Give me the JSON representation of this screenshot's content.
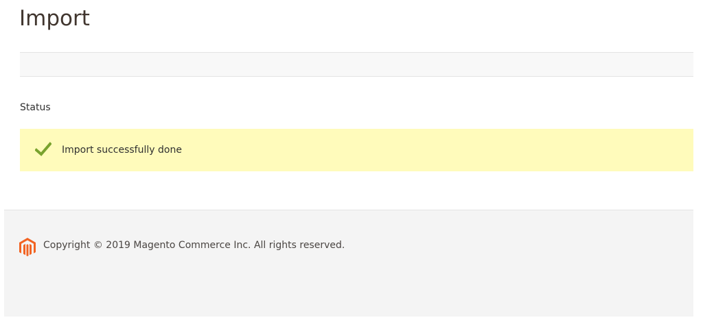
{
  "header": {
    "title": "Import"
  },
  "status_section": {
    "label": "Status",
    "message": {
      "text": "Import successfully done",
      "icon": "checkmark-icon",
      "background_color": "#fffbbb",
      "icon_color": "#79a22e"
    }
  },
  "footer": {
    "logo": "magento-logo-icon",
    "logo_color": "#f26322",
    "copyright": "Copyright © 2019 Magento Commerce Inc. All rights reserved."
  }
}
